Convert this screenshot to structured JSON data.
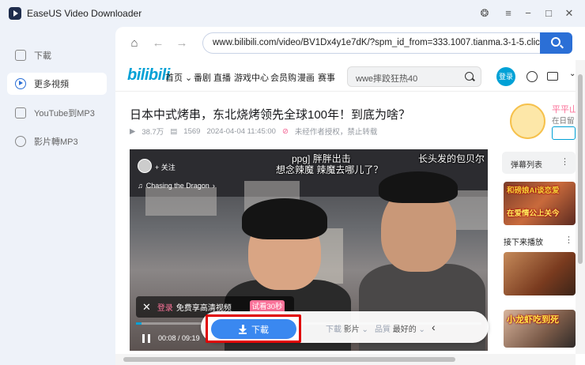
{
  "app": {
    "title": "EaseUS Video Downloader"
  },
  "sidebar": {
    "items": [
      {
        "label": "下載",
        "icon": "download-icon",
        "active": false
      },
      {
        "label": "更多視頻",
        "icon": "play-circle-icon",
        "active": true
      },
      {
        "label": "YouTube到MP3",
        "icon": "youtube-mp3-icon",
        "active": false
      },
      {
        "label": "影片轉MP3",
        "icon": "convert-icon",
        "active": false
      }
    ]
  },
  "browser": {
    "url": "www.bilibili.com/video/BV1Dx4y1e7dK/?spm_id_from=333.1007.tianma.3-1-5.click"
  },
  "bili": {
    "logo": "bilibili",
    "nav": [
      "首页",
      "番剧",
      "直播",
      "游戏中心",
      "会员购",
      "漫画",
      "赛事"
    ],
    "search_placeholder": "wwe摔跤狂热40",
    "login": "登录"
  },
  "video": {
    "title": "日本中式烤串，东北烧烤领先全球100年！到底为啥？",
    "views": "38.7万",
    "danmaku_count": "1569",
    "date": "2024-04-04 11:45:00",
    "notice": "未经作者授权，禁止转载",
    "follow": "+ 关注",
    "music": "Chasing the Dragon",
    "danmaku": [
      "ppg] 胖胖出击",
      "想念辣魔 辣魔去哪儿了？",
      "长头发的包贝尔"
    ],
    "promo_login": "登录",
    "promo_text": "免费享高清视频",
    "trial": "试看30秒",
    "progress": 0.015,
    "current_time": "00:08",
    "total_time": "09:19"
  },
  "downloader": {
    "download_label": "下載",
    "format_label": "下載",
    "format_value": "影片",
    "quality_label": "品質",
    "quality_value": "最好的"
  },
  "sidepanel": {
    "rec_name": "平平山",
    "rec_sub": "在日留",
    "danmaku_list": "弹幕列表",
    "thumb1": "和磅娘AI谈恋爱",
    "thumb1b": "在爱情公上关今",
    "next_heading": "接下来播放",
    "thumb3": "小龙虾吃到死"
  },
  "colors": {
    "accent": "#2b6fd6",
    "bili_blue": "#00a1d6",
    "bili_pink": "#fb7299",
    "highlight_red": "#e00000"
  }
}
